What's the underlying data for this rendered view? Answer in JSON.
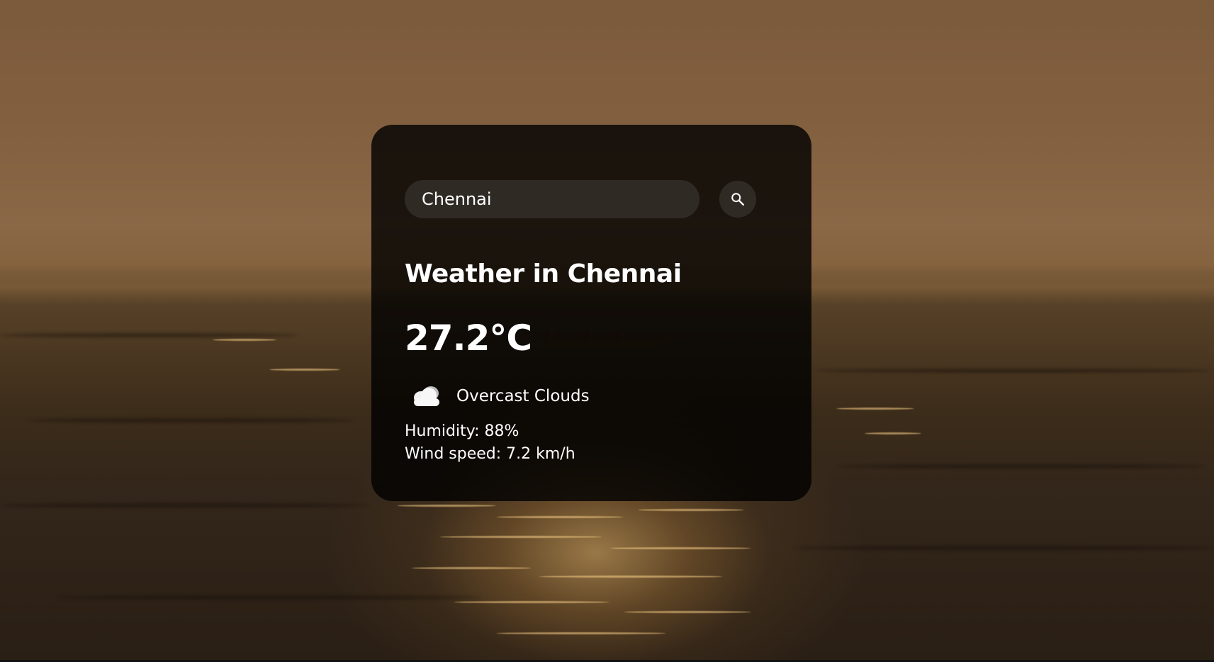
{
  "search": {
    "value": "Chennai",
    "button_icon": "search-icon"
  },
  "weather": {
    "title": "Weather in Chennai",
    "temperature": "27.2°C",
    "condition_icon": "cloud-icon",
    "description": "Overcast Clouds",
    "humidity": "Humidity: 88%",
    "wind": "Wind speed: 7.2 km/h"
  },
  "colors": {
    "card_background": "#000000",
    "text": "#ffffff",
    "field_background": "#4a4a4a"
  }
}
